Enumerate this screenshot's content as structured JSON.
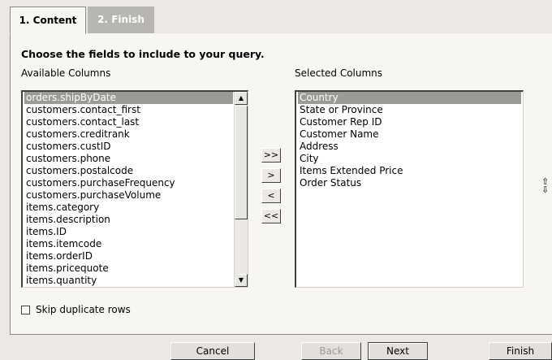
{
  "tabs": [
    {
      "label": "1. Content",
      "active": true
    },
    {
      "label": "2. Finish",
      "active": false
    }
  ],
  "heading": "Choose the fields to include to your query.",
  "available": {
    "label": "Available Columns",
    "items": [
      "orders.shipByDate",
      "customers.contact_first",
      "customers.contact_last",
      "customers.creditrank",
      "customers.custID",
      "customers.phone",
      "customers.postalcode",
      "customers.purchaseFrequency",
      "customers.purchaseVolume",
      "items.category",
      "items.description",
      "items.ID",
      "items.itemcode",
      "items.orderID",
      "items.pricequote",
      "items.quantity"
    ],
    "selected_index": 0
  },
  "selected": {
    "label": "Selected Columns",
    "items": [
      "Country",
      "State or Province",
      "Customer Rep ID",
      "Customer Name",
      "Address",
      "City",
      "Items Extended Price",
      "Order Status"
    ],
    "selected_index": 0
  },
  "move_buttons": {
    "add_all": ">>",
    "add": ">",
    "remove": "<",
    "remove_all": "<<"
  },
  "reorder": {
    "up": "⇧",
    "down": "⇩"
  },
  "scroll": {
    "up": "▲",
    "down": "▼"
  },
  "skip_duplicates": {
    "label": "Skip duplicate rows",
    "checked": false
  },
  "footer": {
    "cancel": "Cancel",
    "back": "Back",
    "next": "Next",
    "finish": "Finish"
  },
  "colors": {
    "background": "#ece9e4",
    "panel": "#f7f6f3",
    "selection": "#9c9a96",
    "inactive_tab": "#b8b6b3"
  }
}
